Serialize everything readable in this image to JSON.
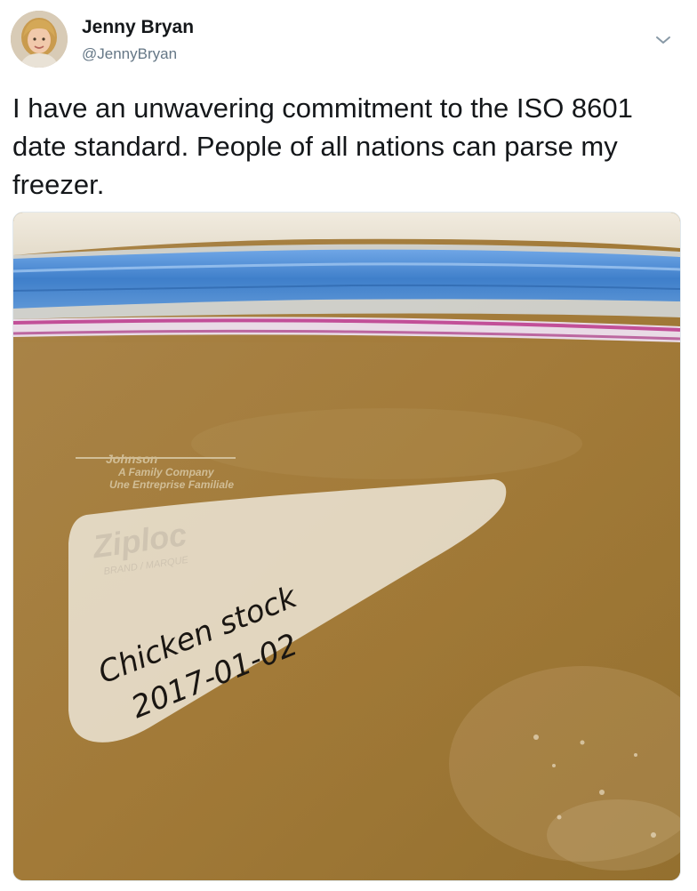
{
  "tweet": {
    "author_name": "Jenny Bryan",
    "author_handle": "@JennyBryan",
    "text": "I have an unwavering commitment to the ISO 8601 date standard. People of all nations can parse my freezer."
  },
  "icons": {
    "menu": "chevron-down-icon",
    "avatar": "avatar-photo"
  },
  "photo": {
    "brand": "Ziploc",
    "johnson_logo": "Johnson",
    "company_line_en": "A Family Company",
    "company_line_fr": "Une Entreprise Familiale",
    "brand_sub": "BRAND / MARQUE",
    "handwritten_line1": "Chicken stock",
    "handwritten_line2": "2017-01-02"
  },
  "colors": {
    "text": "#14171a",
    "secondary": "#657786",
    "border": "#e1e8ed",
    "broth": "#a9823f",
    "zip_blue": "#4f8fd6",
    "zip_pink": "#c4509a"
  }
}
